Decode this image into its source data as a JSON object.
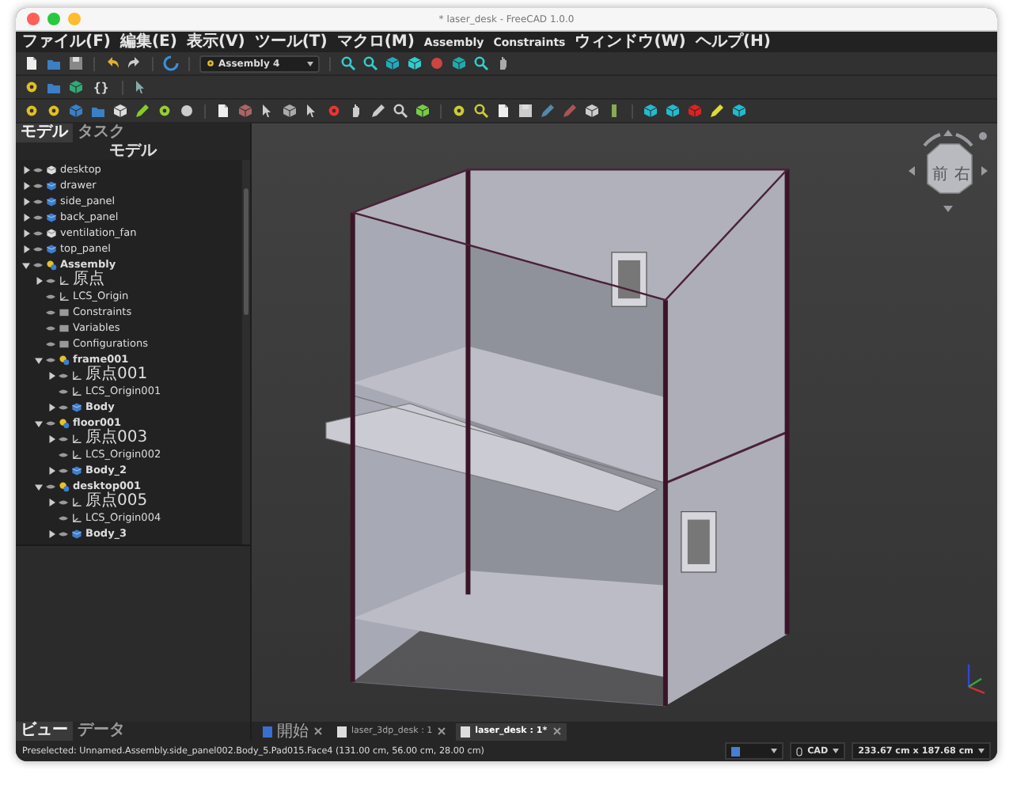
{
  "window": {
    "title": "* laser_desk - FreeCAD 1.0.0"
  },
  "menu": [
    "ファイル(F)",
    "編集(E)",
    "表示(V)",
    "ツール(T)",
    "マクロ(M)",
    "Assembly",
    "Constraints",
    "ウィンドウ(W)",
    "ヘルプ(H)"
  ],
  "workbench_selector": {
    "value": "Assembly 4"
  },
  "macro_button": "{}",
  "left_panel": {
    "tabs": [
      {
        "label": "モデル",
        "selected": true
      },
      {
        "label": "タスク",
        "selected": false
      }
    ],
    "header": "モデル",
    "tree": [
      {
        "label": "desktop",
        "kind": "part",
        "bold": false,
        "expanded": false
      },
      {
        "label": "drawer",
        "kind": "body",
        "bold": false,
        "expanded": false
      },
      {
        "label": "side_panel",
        "kind": "body",
        "bold": false,
        "expanded": false
      },
      {
        "label": "back_panel",
        "kind": "body",
        "bold": false,
        "expanded": false
      },
      {
        "label": "ventilation_fan",
        "kind": "part",
        "bold": false,
        "expanded": false
      },
      {
        "label": "top_panel",
        "kind": "body",
        "bold": false,
        "expanded": false
      },
      {
        "label": "Assembly",
        "kind": "assembly",
        "bold": true,
        "expanded": true,
        "children": [
          {
            "label": "原点",
            "kind": "origin",
            "bold": false,
            "expanded": false
          },
          {
            "label": "LCS_Origin",
            "kind": "origin",
            "bold": false
          },
          {
            "label": "Constraints",
            "kind": "group",
            "bold": false
          },
          {
            "label": "Variables",
            "kind": "group",
            "bold": false
          },
          {
            "label": "Configurations",
            "kind": "group",
            "bold": false
          },
          {
            "label": "frame001",
            "kind": "assembly",
            "bold": true,
            "expanded": true,
            "children": [
              {
                "label": "原点001",
                "kind": "origin",
                "bold": false,
                "expanded": false
              },
              {
                "label": "LCS_Origin001",
                "kind": "origin",
                "bold": false
              },
              {
                "label": "Body",
                "kind": "body",
                "bold": true,
                "expanded": false
              }
            ]
          },
          {
            "label": "floor001",
            "kind": "assembly",
            "bold": true,
            "expanded": true,
            "children": [
              {
                "label": "原点003",
                "kind": "origin",
                "bold": false,
                "expanded": false
              },
              {
                "label": "LCS_Origin002",
                "kind": "origin",
                "bold": false
              },
              {
                "label": "Body_2",
                "kind": "body",
                "bold": true,
                "expanded": false
              }
            ]
          },
          {
            "label": "desktop001",
            "kind": "assembly",
            "bold": true,
            "expanded": true,
            "children": [
              {
                "label": "原点005",
                "kind": "origin",
                "bold": false,
                "expanded": false
              },
              {
                "label": "LCS_Origin004",
                "kind": "origin",
                "bold": false
              },
              {
                "label": "Body_3",
                "kind": "body",
                "bold": true,
                "expanded": false
              }
            ]
          }
        ]
      }
    ],
    "bottom_tabs": [
      {
        "label": "ビュー",
        "selected": true
      },
      {
        "label": "データ",
        "selected": false
      }
    ]
  },
  "nav_cube": {
    "faces": [
      "前",
      "右"
    ]
  },
  "document_tabs": [
    {
      "label": "開始",
      "kind": "start",
      "selected": false
    },
    {
      "label": "laser_3dp_desk : 1",
      "kind": "document",
      "selected": false
    },
    {
      "label": "laser_desk : 1*",
      "kind": "document",
      "selected": true
    }
  ],
  "status_bar": {
    "message": "Preselected: Unnamed.Assembly.side_panel002.Body_5.Pad015.Face4 (131.00 cm, 56.00 cm, 28.00 cm)",
    "navigation_style": "CAD",
    "dimensions": "233.67 cm x 187.68 cm"
  }
}
